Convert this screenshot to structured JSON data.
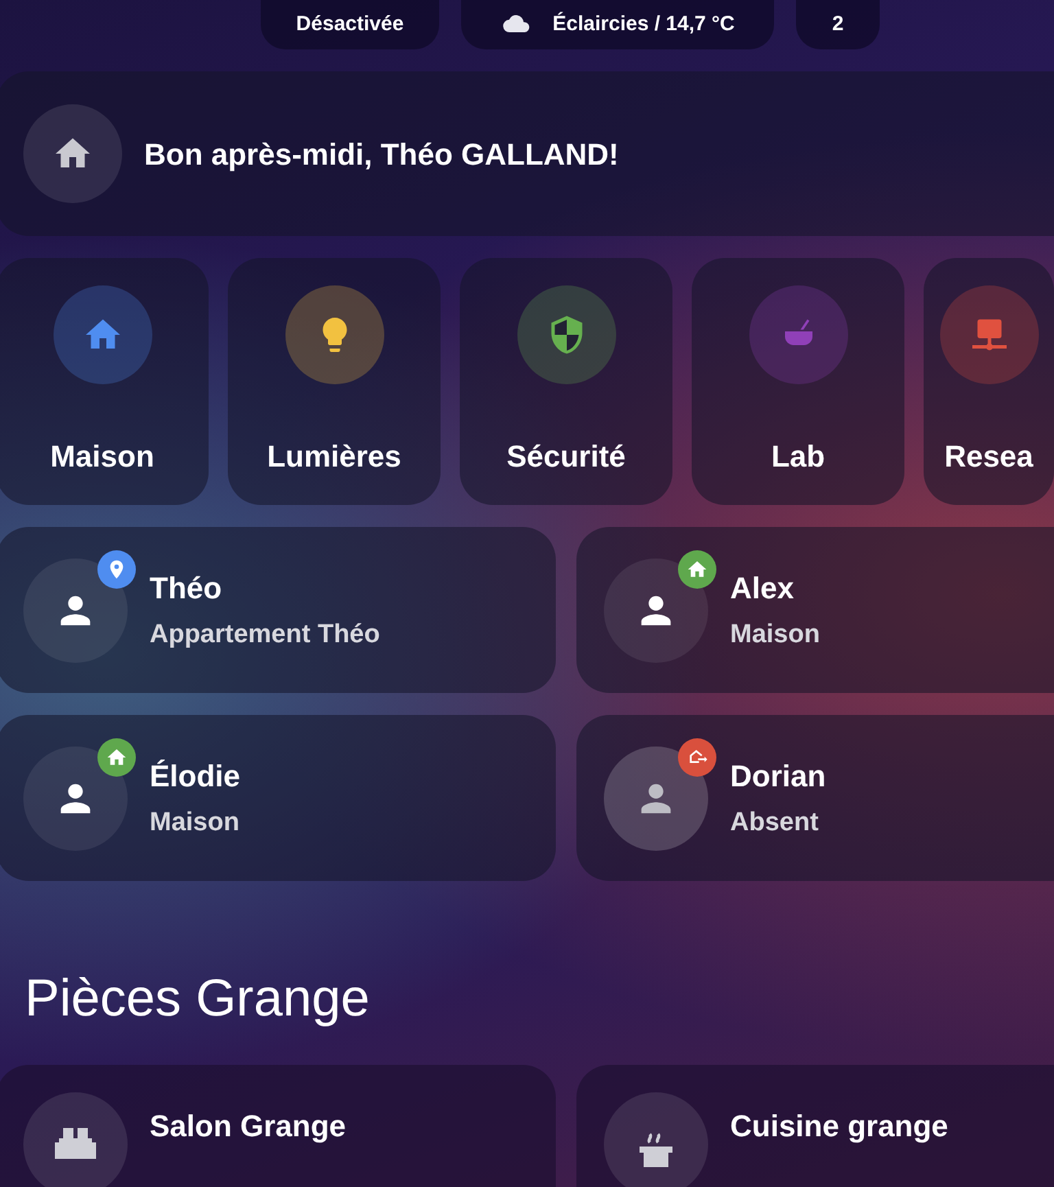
{
  "chips": [
    {
      "kind": "text",
      "label": "Désactivée"
    },
    {
      "kind": "weather",
      "label": "Éclaircies / 14,7 °C"
    },
    {
      "kind": "text",
      "label": "2"
    }
  ],
  "greeting": {
    "text": "Bon après-midi, Théo GALLAND!"
  },
  "tiles": [
    {
      "kind": "home",
      "label": "Maison",
      "color": "#4f8df0"
    },
    {
      "kind": "bulb",
      "label": "Lumières",
      "color": "#f2c140"
    },
    {
      "kind": "shield",
      "label": "Sécurité",
      "color": "#66b04f"
    },
    {
      "kind": "pot",
      "label": "Lab",
      "color": "#9040b8"
    },
    {
      "kind": "network",
      "label": "Resea",
      "color": "#e0513f"
    }
  ],
  "people": [
    {
      "name": "Théo",
      "location": "Appartement Théo",
      "away": false,
      "badge": {
        "kind": "pin",
        "color": "#4f8df0"
      }
    },
    {
      "name": "Alex",
      "location": "Maison",
      "away": false,
      "badge": {
        "kind": "home",
        "color": "#5fa84d"
      }
    },
    {
      "name": "Élodie",
      "location": "Maison",
      "away": false,
      "badge": {
        "kind": "home",
        "color": "#5fa84d"
      }
    },
    {
      "name": "Dorian",
      "location": "Absent",
      "away": true,
      "badge": {
        "kind": "away",
        "color": "#d9503d"
      }
    }
  ],
  "section": {
    "title": "Pièces Grange"
  },
  "rooms": [
    {
      "kind": "sofa",
      "name": "Salon Grange"
    },
    {
      "kind": "stove",
      "name": "Cuisine grange"
    }
  ]
}
